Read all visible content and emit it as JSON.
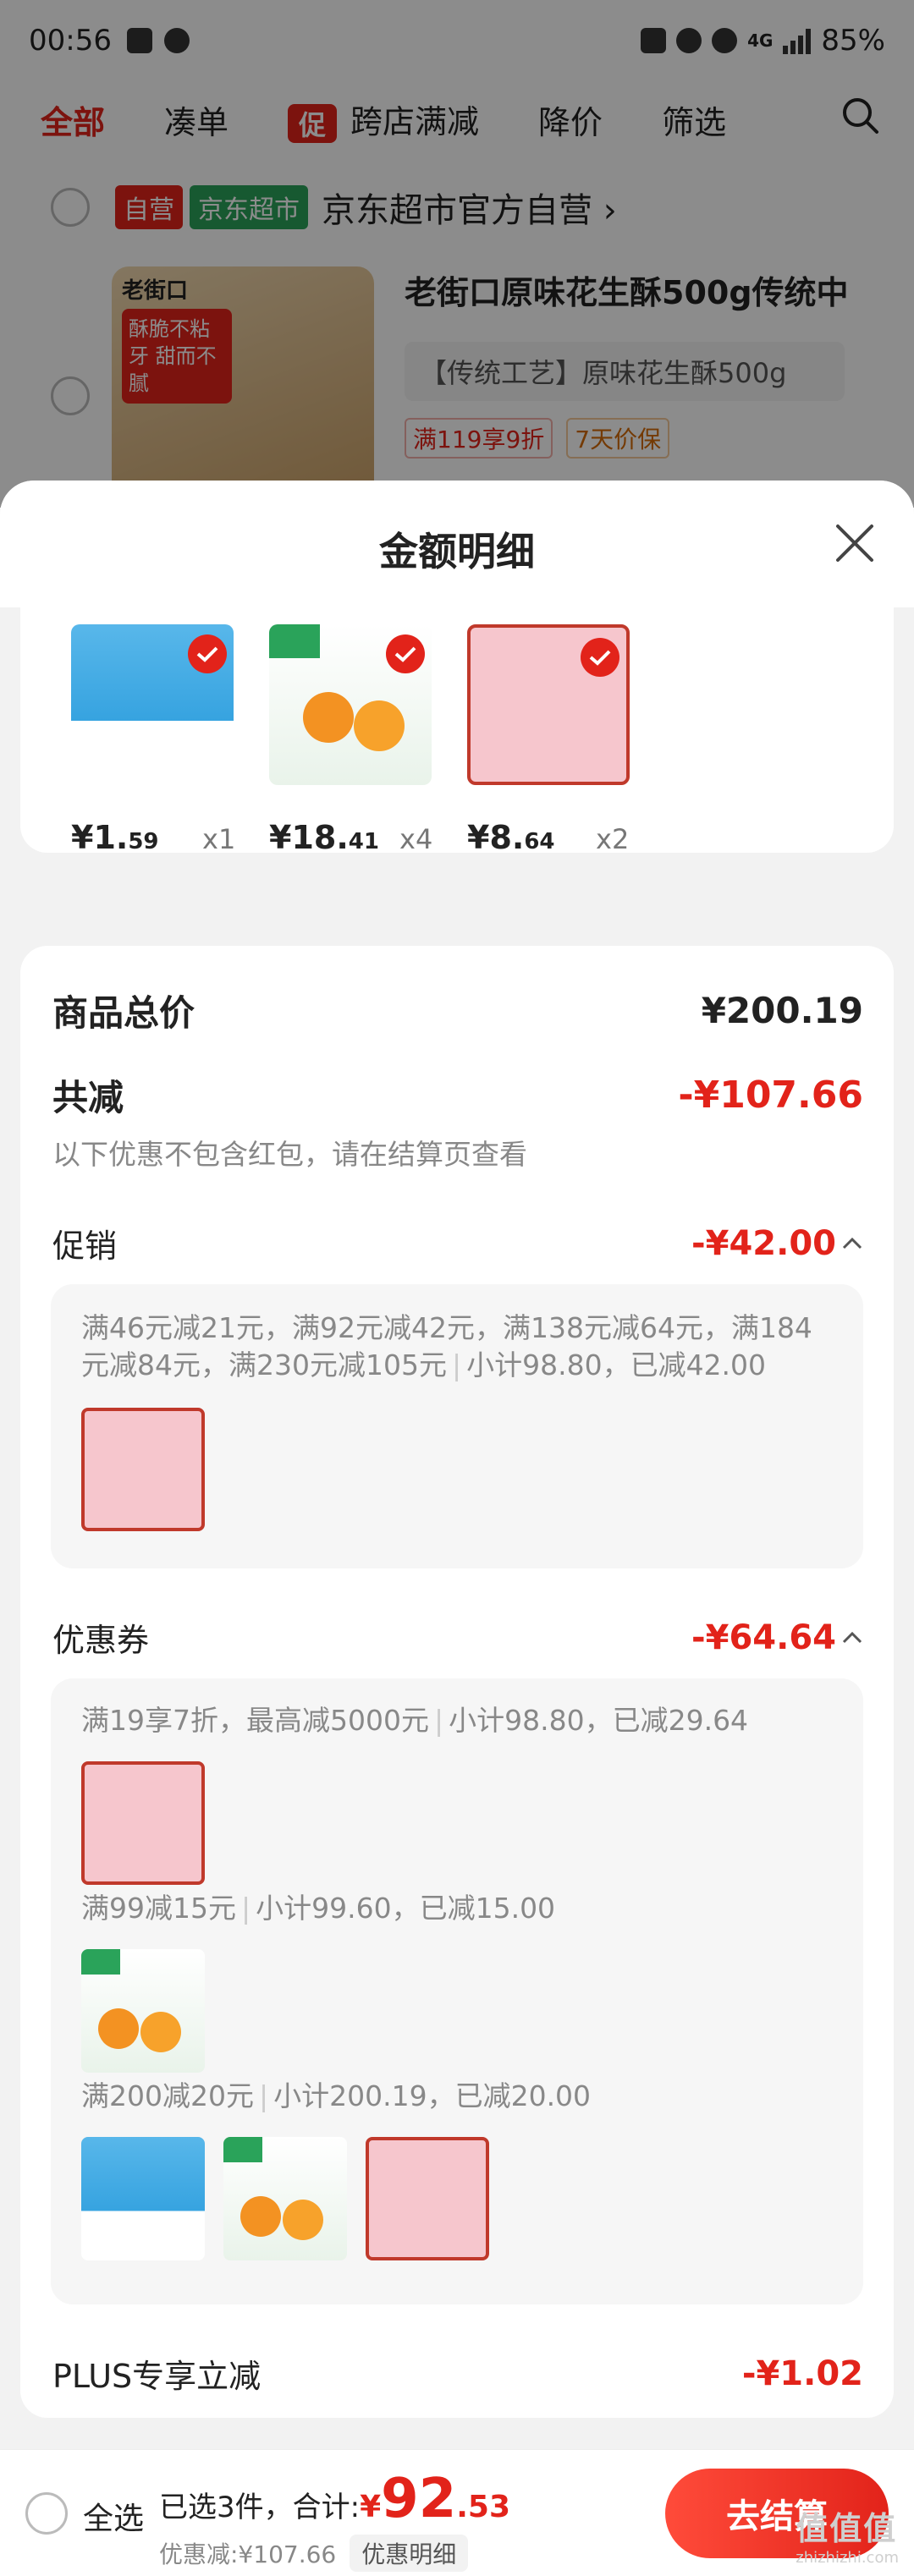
{
  "status_bar": {
    "time": "00:56",
    "battery": "85%",
    "network": "4G"
  },
  "filter_bar": {
    "tabs": [
      "全部",
      "凑单",
      "跨店满减",
      "降价",
      "筛选"
    ],
    "promo_badge": "促",
    "active": 0
  },
  "shop": {
    "tag_self": "自营",
    "tag_supermarket": "京东超市",
    "name": "京东超市官方自营",
    "chevron": "›"
  },
  "product": {
    "title": "老街口原味花生酥500g传统中",
    "spec": "【传统工艺】原味花生酥500g",
    "tags": [
      "满119享9折",
      "7天价保"
    ],
    "image_text": "酥脆不粘牙 甜而不腻",
    "brand_text": "老街口"
  },
  "sheet": {
    "title": "金额明细"
  },
  "items": [
    {
      "price_int": "¥1.",
      "price_dec": "59",
      "qty": "x1",
      "icon": "glue-product"
    },
    {
      "price_int": "¥18.",
      "price_dec": "41",
      "qty": "x4",
      "icon": "orange-product"
    },
    {
      "price_int": "¥8.",
      "price_dec": "64",
      "qty": "x2",
      "icon": "tissue-product"
    }
  ],
  "summary": {
    "total_label": "商品总价",
    "total_value": "¥200.19",
    "discount_label": "共减",
    "discount_value": "-¥107.66",
    "discount_note": "以下优惠不包含红包，请在结算页查看"
  },
  "promotion": {
    "label": "促销",
    "value": "-¥42.00",
    "rule": "满46元减21元，满92元减42元，满138元减64元，满184元减84元，满230元减105元",
    "subtotal": "小计98.80，已减42.00"
  },
  "coupon": {
    "label": "优惠券",
    "value": "-¥64.64",
    "rules": [
      {
        "rule": "满19享7折，最高减5000元",
        "subtotal": "小计98.80，已减29.64"
      },
      {
        "rule": "满99减15元",
        "subtotal": "小计99.60，已减15.00"
      },
      {
        "rule": "满200减20元",
        "subtotal": "小计200.19，已减20.00"
      }
    ]
  },
  "plus": {
    "label": "PLUS专享立减",
    "value": "-¥1.02"
  },
  "bottom_bar": {
    "select_all": "全选",
    "selected": "已选3件，合计:",
    "currency": "¥",
    "total_int": "92",
    "total_dec": ".53",
    "discount": "优惠减:¥107.66",
    "detail": "优惠明细",
    "checkout": "去结算"
  },
  "watermark": {
    "text": "值值值",
    "sub": "zhizhizhi.com"
  },
  "colors": {
    "accent": "#e2231a",
    "green": "#2aa35a",
    "gray_text": "#888888"
  }
}
